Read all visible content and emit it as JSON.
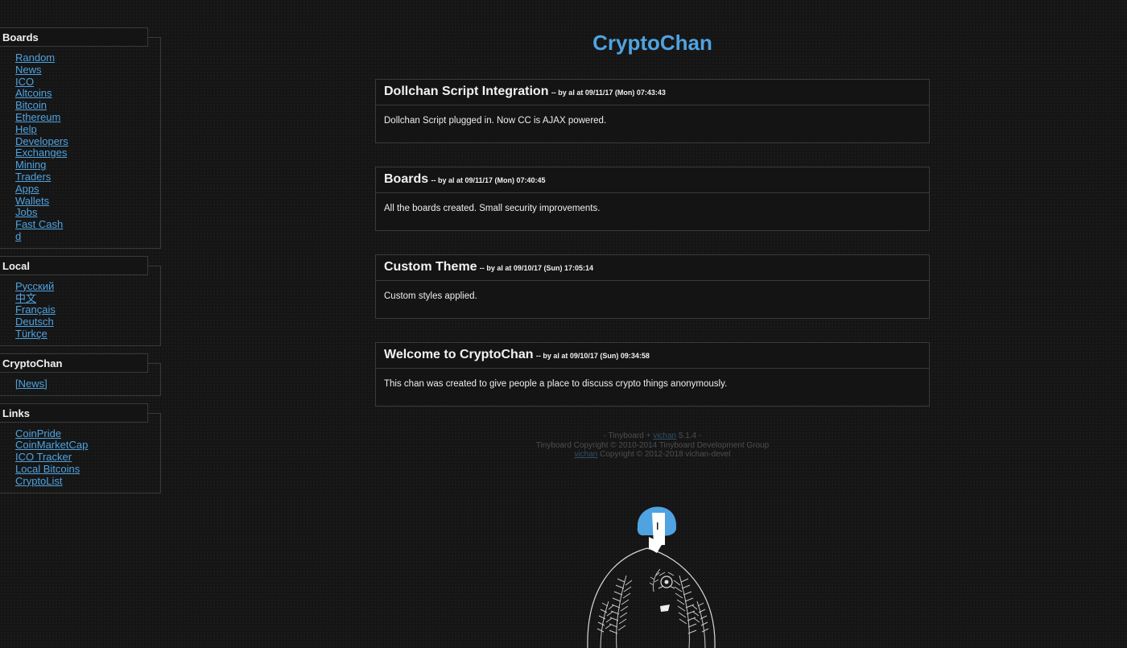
{
  "sidebar": {
    "boards": {
      "title": "Boards",
      "links": [
        "Random",
        "News",
        "ICO",
        "Altcoins",
        "Bitcoin",
        "Ethereum",
        "Help",
        "Developers",
        "Exchanges",
        "Mining",
        "Traders",
        "Apps",
        "Wallets",
        "Jobs",
        "Fast Cash",
        "d"
      ]
    },
    "local": {
      "title": "Local",
      "links": [
        "Русский",
        "中文",
        "Français",
        "Deutsch",
        "Türkçe"
      ]
    },
    "cryptochan": {
      "title": "CryptoChan",
      "links": [
        "[News]"
      ]
    },
    "links": {
      "title": "Links",
      "links": [
        "CoinPride",
        "CoinMarketCap",
        "ICO Tracker",
        "Local Bitcoins",
        "CryptoList"
      ]
    }
  },
  "main": {
    "site_title": "CryptoChan",
    "posts": [
      {
        "title": "Dollchan Script Integration",
        "meta": "-- by al at 09/11/17 (Mon) 07:43:43",
        "body": "Dollchan Script plugged in. Now CC is AJAX powered."
      },
      {
        "title": "Boards",
        "meta": "-- by al at 09/11/17 (Mon) 07:40:45",
        "body": "All the boards created. Small security improvements."
      },
      {
        "title": "Custom Theme",
        "meta": "-- by al at 09/10/17 (Sun) 17:05:14",
        "body": "Custom styles applied."
      },
      {
        "title": "Welcome to CryptoChan",
        "meta": "-- by al at 09/10/17 (Sun) 09:34:58",
        "body": "This chan was created to give people a place to discuss crypto things anonymously."
      }
    ]
  },
  "footer": {
    "line1_prefix": "- Tinyboard +",
    "line1_link": "vichan",
    "line1_suffix": "5.1.4 -",
    "line2": "Tinyboard Copyright © 2010-2014 Tinyboard Development Group",
    "line3_link": "vichan",
    "line3_suffix": "Copyright © 2012-2018 vichan-devel"
  },
  "colors": {
    "accent": "#4fa3e0",
    "background": "#151515",
    "border": "#3a3a3a",
    "text": "#e6e6e6"
  }
}
